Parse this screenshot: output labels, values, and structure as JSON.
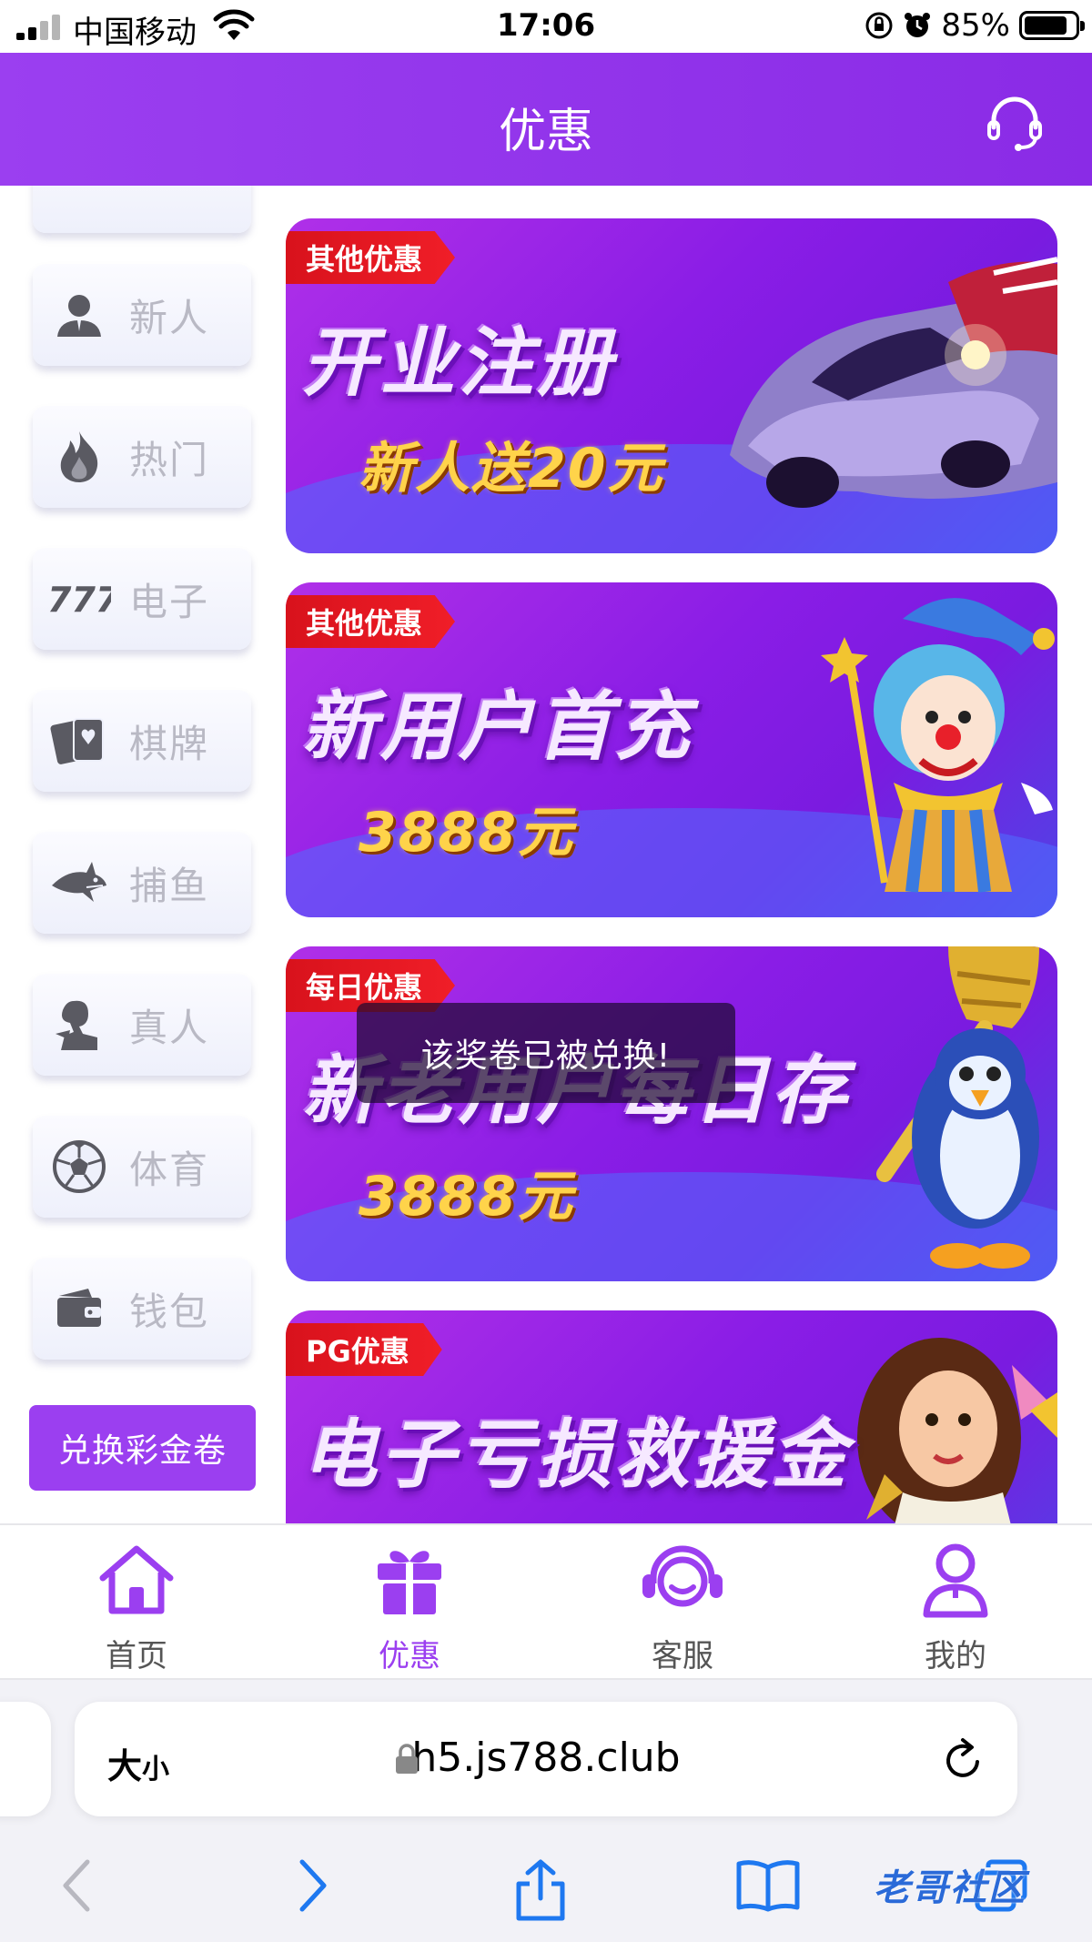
{
  "status_bar": {
    "carrier": "中国移动",
    "time": "17:06",
    "battery": "85%",
    "battery_level": 0.85
  },
  "header": {
    "title": "优惠",
    "support_icon": "headset-icon"
  },
  "sidebar": {
    "items": [
      {
        "label": "新人",
        "icon": "user-icon"
      },
      {
        "label": "热门",
        "icon": "flame-icon"
      },
      {
        "label": "电子",
        "icon": "slot-777-icon"
      },
      {
        "label": "棋牌",
        "icon": "cards-icon"
      },
      {
        "label": "捕鱼",
        "icon": "shark-icon"
      },
      {
        "label": "真人",
        "icon": "dealer-icon"
      },
      {
        "label": "体育",
        "icon": "soccer-ball-icon"
      },
      {
        "label": "钱包",
        "icon": "wallet-icon"
      }
    ],
    "redeem_button": "兑换彩金卷"
  },
  "banners": [
    {
      "tag": "其他优惠",
      "headline": "开业注册",
      "amount": "新人送20元",
      "art": "race-car"
    },
    {
      "tag": "其他优惠",
      "headline": "新用户首充",
      "amount": "3888元",
      "art": "clown"
    },
    {
      "tag": "每日优惠",
      "headline": "新老用户每日存",
      "amount": "3888元",
      "art": "penguin"
    },
    {
      "tag": "PG优惠",
      "headline": "电子亏损救援金",
      "amount": "",
      "art": "girl"
    }
  ],
  "toast": "该奖卷已被兑换!",
  "tabbar": {
    "tabs": [
      {
        "label": "首页",
        "icon": "home-icon",
        "active": false
      },
      {
        "label": "优惠",
        "icon": "gift-icon",
        "active": true
      },
      {
        "label": "客服",
        "icon": "headset-icon",
        "active": false
      },
      {
        "label": "我的",
        "icon": "profile-icon",
        "active": false
      }
    ]
  },
  "browser": {
    "text_size_big": "大",
    "text_size_small": "小",
    "url": "h5.js788.club",
    "watermark": "老哥社区"
  },
  "colors": {
    "brand_purple": "#9b3ff0",
    "tag_red": "#e3161f",
    "amount_gold": "#ffd34a"
  }
}
